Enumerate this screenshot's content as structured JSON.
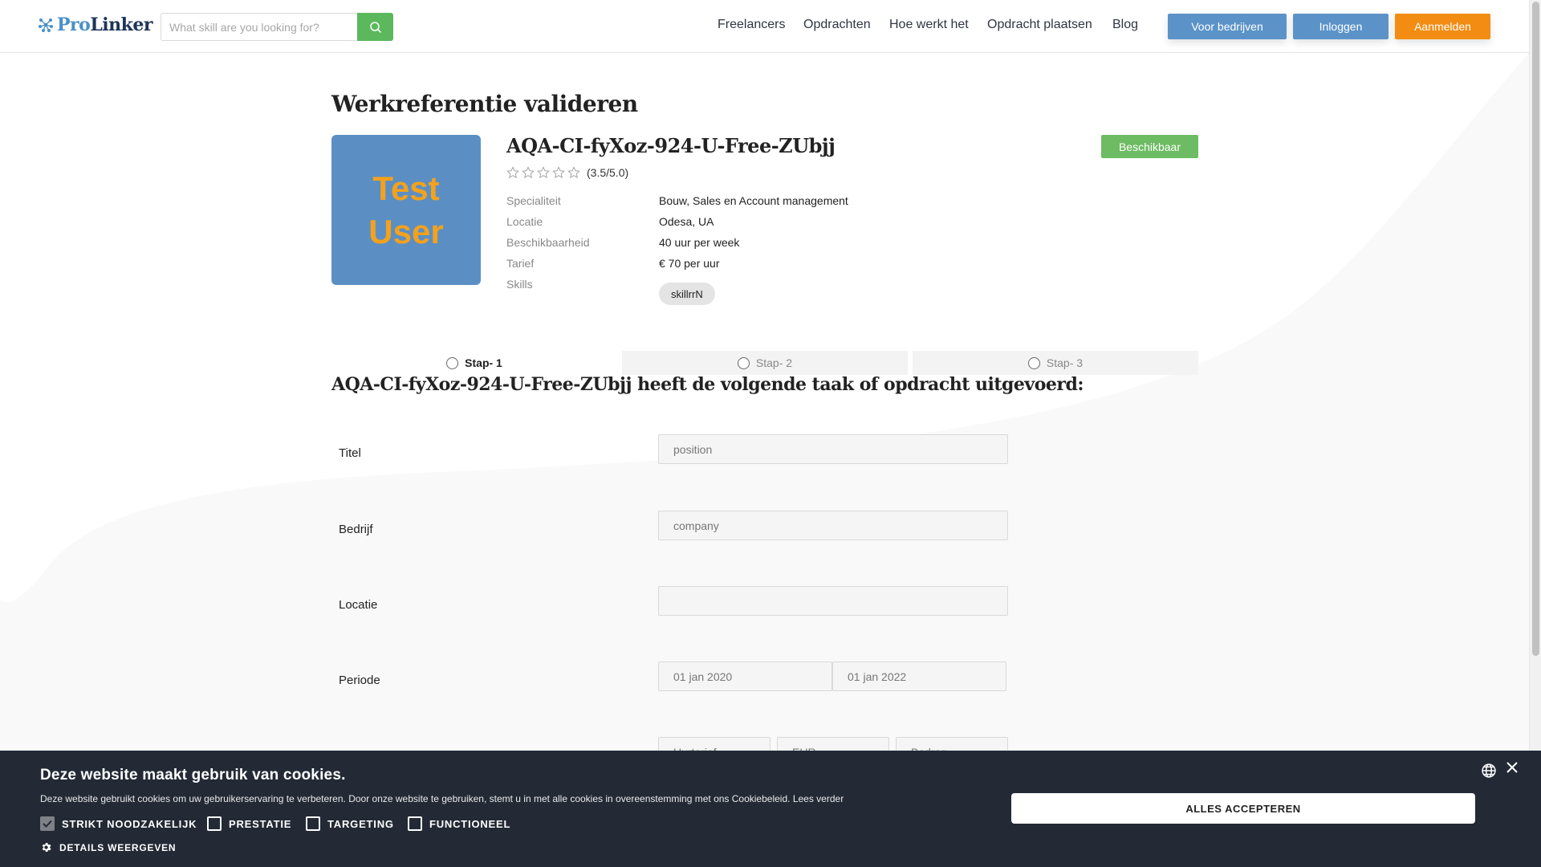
{
  "header": {
    "logo_pro": "Pro",
    "logo_linker": "Linker",
    "search_placeholder": "What skill are you looking for?",
    "nav": [
      "Freelancers",
      "Opdrachten",
      "Hoe werkt het",
      "Opdracht plaatsen",
      "Blog"
    ],
    "btn_companies": "Voor bedrijven",
    "btn_login": "Inloggen",
    "btn_register": "Aanmelden"
  },
  "page_title": "Werkreferentie valideren",
  "profile": {
    "avatar_line1": "Test",
    "avatar_line2": "User",
    "name": "AQA-CI-fyXoz-924-U-Free-ZUbjj",
    "rating": "(3.5/5.0)",
    "rating_value": 3.5,
    "rating_max": 5,
    "status": "Beschikbaar",
    "info": [
      {
        "label": "Specialiteit",
        "value": "Bouw, Sales en Account management"
      },
      {
        "label": "Locatie",
        "value": "Odesa, UA"
      },
      {
        "label": "Beschikbaarheid",
        "value": "40 uur per week"
      },
      {
        "label": "Tarief",
        "value": "€ 70 per uur"
      },
      {
        "label": "Skills",
        "value": ""
      }
    ],
    "skills": [
      "skillrrN"
    ]
  },
  "steps": [
    "Stap- 1",
    "Stap- 2",
    "Stap- 3"
  ],
  "section_title": "AQA-CI-fyXoz-924-U-Free-ZUbjj heeft de volgende taak of opdracht uitgevoerd:",
  "form": {
    "title_label": "Titel",
    "title_value": "position",
    "company_label": "Bedrijf",
    "company_value": "company",
    "location_label": "Locatie",
    "location_value": "",
    "period_label": "Periode",
    "period_start": "01 jan 2020",
    "period_end": "01 jan 2022",
    "rate_type": "Uurtarief",
    "currency": "EUR",
    "amount": "Bedrag"
  },
  "cookie": {
    "title": "Deze website maakt gebruik van cookies.",
    "text": "Deze website gebruikt cookies om uw gebruikerservaring te verbeteren. Door onze website te gebruiken, stemt u in met alle cookies in overeenstemming met ons Cookiebeleid.",
    "read_more": "Lees verder",
    "checkboxes": [
      {
        "label": "STRIKT NOODZAKELIJK",
        "checked": true
      },
      {
        "label": "PRESTATIE",
        "checked": false
      },
      {
        "label": "TARGETING",
        "checked": false
      },
      {
        "label": "FUNCTIONEEL",
        "checked": false
      }
    ],
    "details": "DETAILS WEERGEVEN",
    "accept": "ALLES ACCEPTEREN"
  },
  "colors": {
    "primary_blue": "#5b93c8",
    "accent_orange": "#f28c13",
    "success_green": "#6dbb62",
    "search_green": "#5cb85c",
    "cookie_bg": "#232a36"
  }
}
